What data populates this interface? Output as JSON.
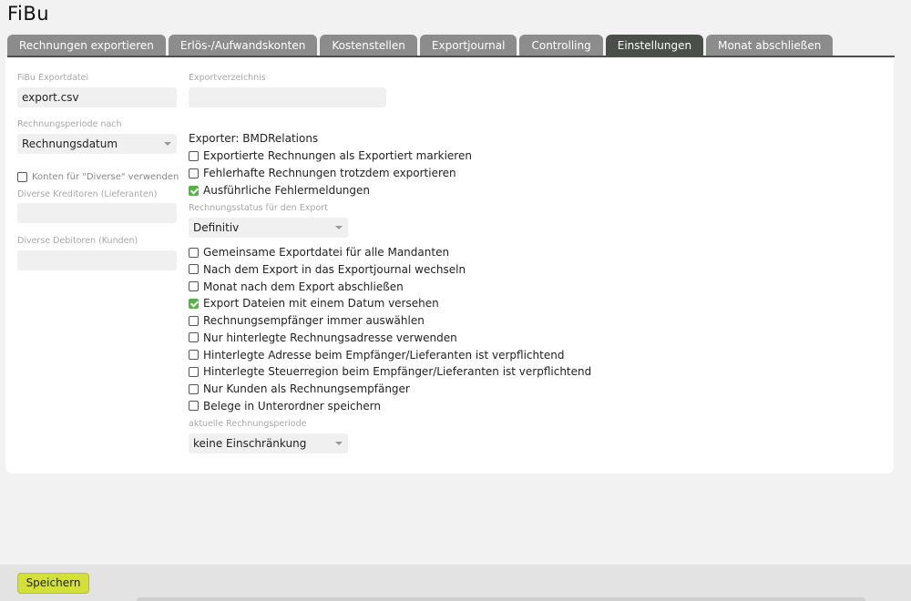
{
  "page": {
    "title": "FiBu"
  },
  "tabs": [
    {
      "label": "Rechnungen exportieren",
      "active": false
    },
    {
      "label": "Erlös-/Aufwandskonten",
      "active": false
    },
    {
      "label": "Kostenstellen",
      "active": false
    },
    {
      "label": "Exportjournal",
      "active": false
    },
    {
      "label": "Controlling",
      "active": false
    },
    {
      "label": "Einstellungen",
      "active": true
    },
    {
      "label": "Monat abschließen",
      "active": false
    }
  ],
  "left": {
    "export_file_label": "FiBu Exportdatei",
    "export_file_value": "export.csv",
    "period_label": "Rechnungsperiode nach",
    "period_value": "Rechnungsdatum",
    "diverse_label": "Konten für \"Diverse\" verwenden",
    "diverse_checked": false,
    "creditors_label": "Diverse Kreditoren (Lieferanten)",
    "creditors_value": "",
    "debtors_label": "Diverse Debitoren (Kunden)",
    "debtors_value": ""
  },
  "right": {
    "export_dir_label": "Exportverzeichnis",
    "export_dir_value": "",
    "exporter_heading": "Exporter: BMDRelations",
    "options_a": [
      {
        "label": "Exportierte Rechnungen als Exportiert markieren",
        "checked": false
      },
      {
        "label": "Fehlerhafte Rechnungen trotzdem exportieren",
        "checked": false
      },
      {
        "label": "Ausführliche Fehlermeldungen",
        "checked": true
      }
    ],
    "status_label": "Rechnungsstatus für den Export",
    "status_value": "Definitiv",
    "options_b": [
      {
        "label": "Gemeinsame Exportdatei für alle Mandanten",
        "checked": false
      },
      {
        "label": "Nach dem Export in das Exportjournal wechseln",
        "checked": false
      },
      {
        "label": "Monat nach dem Export abschließen",
        "checked": false
      },
      {
        "label": "Export Dateien mit einem Datum versehen",
        "checked": true
      },
      {
        "label": "Rechnungsempfänger immer auswählen",
        "checked": false
      },
      {
        "label": "Nur hinterlegte Rechnungsadresse verwenden",
        "checked": false
      },
      {
        "label": "Hinterlegte Adresse beim Empfänger/Lieferanten ist verpflichtend",
        "checked": false
      },
      {
        "label": "Hinterlegte Steuerregion beim Empfänger/Lieferanten ist verpflichtend",
        "checked": false
      },
      {
        "label": "Nur Kunden als Rechnungsempfänger",
        "checked": false
      },
      {
        "label": "Belege in Unterordner speichern",
        "checked": false
      }
    ],
    "current_period_label": "aktuelle Rechnungsperiode",
    "current_period_value": "keine Einschränkung"
  },
  "footer": {
    "save_label": "Speichern"
  }
}
